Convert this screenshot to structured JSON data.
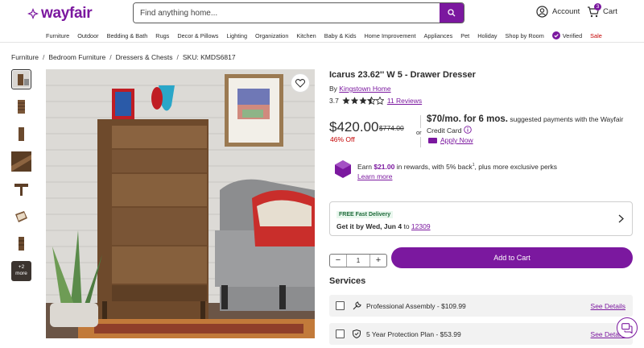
{
  "brand": {
    "name": "wayfair",
    "accent_color": "#7b189f",
    "sale_color": "#c40000"
  },
  "header": {
    "search_placeholder": "Find anything home...",
    "account_label": "Account",
    "cart_label": "Cart",
    "cart_count": "3"
  },
  "nav": {
    "items": [
      "Furniture",
      "Outdoor",
      "Bedding & Bath",
      "Rugs",
      "Decor & Pillows",
      "Lighting",
      "Organization",
      "Kitchen",
      "Baby & Kids",
      "Home Improvement",
      "Appliances",
      "Pet",
      "Holiday",
      "Shop by Room"
    ],
    "verified": "Verified",
    "sale": "Sale"
  },
  "breadcrumb": {
    "items": [
      "Furniture",
      "Bedroom Furniture",
      "Dressers & Chests"
    ],
    "sku": "SKU: KMDS6817",
    "separator": "/"
  },
  "gallery": {
    "more_label": "+2\nmore",
    "thumb_count": 7
  },
  "product": {
    "title": "Icarus 23.62'' W 5 - Drawer Dresser",
    "by_prefix": "By",
    "brand": "Kingstown Home",
    "rating": "3.7",
    "rating_value": 3.7,
    "reviews": "11 Reviews",
    "price": "$420.00",
    "was_price": "$774.00",
    "discount": "46% Off",
    "or": "or",
    "finance_amount": "$70/mo. for 6 mos.",
    "finance_text": "suggested payments with the Wayfair Credit Card",
    "apply": "Apply Now",
    "rewards_prefix": "Earn",
    "rewards_amount": "$21.00",
    "rewards_text": "in rewards, with 5% back",
    "rewards_sup": "1",
    "rewards_suffix": ", plus more exclusive perks",
    "learn_more": "Learn more"
  },
  "delivery": {
    "badge": "FREE Fast Delivery",
    "text": "Get it by Wed, Jun 4",
    "to": "to",
    "zip": "12309"
  },
  "cart_actions": {
    "quantity": "1",
    "add_to_cart": "Add to Cart"
  },
  "services": {
    "heading": "Services",
    "items": [
      {
        "label": "Professional Assembly - $109.99",
        "link": "See Details",
        "icon": "wrench-icon"
      },
      {
        "label": "5 Year Protection Plan - $53.99",
        "link": "See Details",
        "icon": "shield-icon"
      }
    ]
  }
}
